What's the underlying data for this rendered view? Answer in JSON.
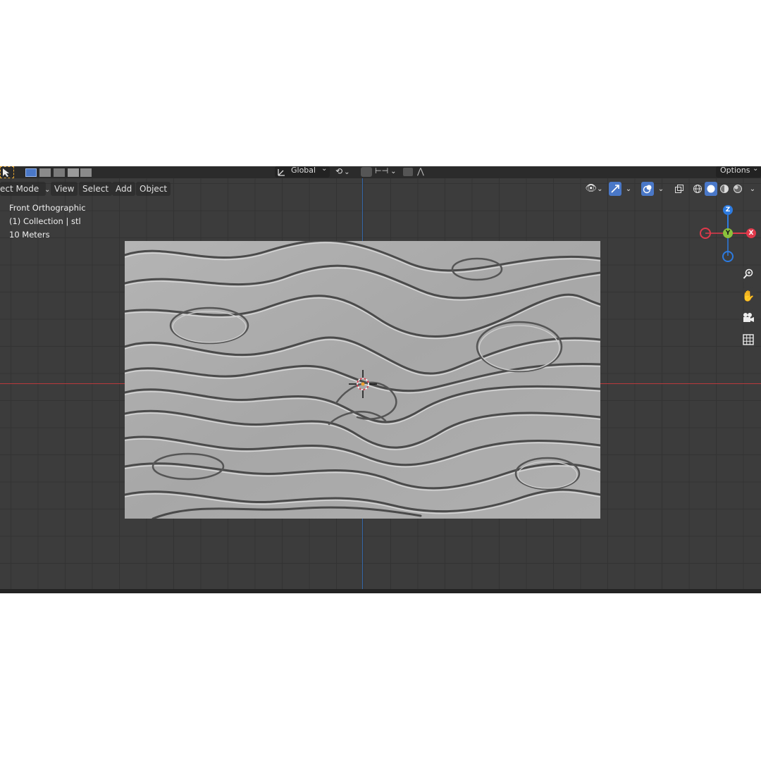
{
  "tool_header": {
    "transform_orientation": "Global",
    "options_label": "Options"
  },
  "header": {
    "mode_label": "ect Mode",
    "menus": [
      "View",
      "Select",
      "Add",
      "Object"
    ]
  },
  "viewport_overlay": {
    "view_name": "Front Orthographic",
    "collection": "(1) Collection | stl",
    "scale": "10 Meters"
  },
  "gizmo": {
    "z_label": "Z",
    "y_label": "Y",
    "x_label": "X"
  },
  "colors": {
    "axis_x": "#e0394b",
    "axis_y": "#8bc23c",
    "axis_z": "#2d7be0",
    "accent": "#4a78c8",
    "viewport_bg": "#3c3c3c",
    "mesh": "#a9a9a9"
  },
  "icons": {
    "zoom": "zoom-icon",
    "pan": "hand-icon",
    "camera": "camera-icon",
    "grid": "grid-icon"
  }
}
